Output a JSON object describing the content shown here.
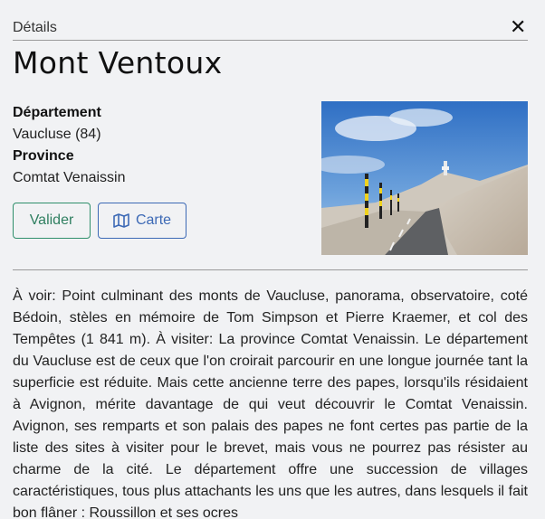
{
  "header": {
    "title": "Détails",
    "close_icon": "close-icon"
  },
  "place": {
    "name": "Mont Ventoux",
    "departement_label": "Département",
    "departement_value": "Vaucluse (84)",
    "province_label": "Province",
    "province_value": "Comtat Venaissin"
  },
  "actions": {
    "valider_label": "Valider",
    "carte_label": "Carte",
    "carte_icon": "map-icon"
  },
  "photo": {
    "subject": "road-to-summit-photo"
  },
  "description": "À voir: Point culminant des monts de Vaucluse, panorama, observatoire, coté Bédoin, stèles en mémoire de Tom Simpson et Pierre Kraemer, et col des Tempêtes (1 841 m). À visiter: La province Comtat Venaissin. Le département du Vaucluse est de ceux que l'on croirait parcourir en une longue journée tant la superficie est réduite. Mais cette ancienne terre des papes, lorsqu'ils résidaient à Avignon, mérite davantage de qui veut découvrir le Comtat Venaissin. Avignon, ses remparts et son palais des papes ne font certes pas partie de la liste des sites à visiter pour le brevet, mais vous ne pourrez pas résister au charme de la cité. Le département offre une succession de villages caractéristiques, tous plus attachants les uns que les autres, dans lesquels il fait bon flâner : Roussillon et ses ocres"
}
